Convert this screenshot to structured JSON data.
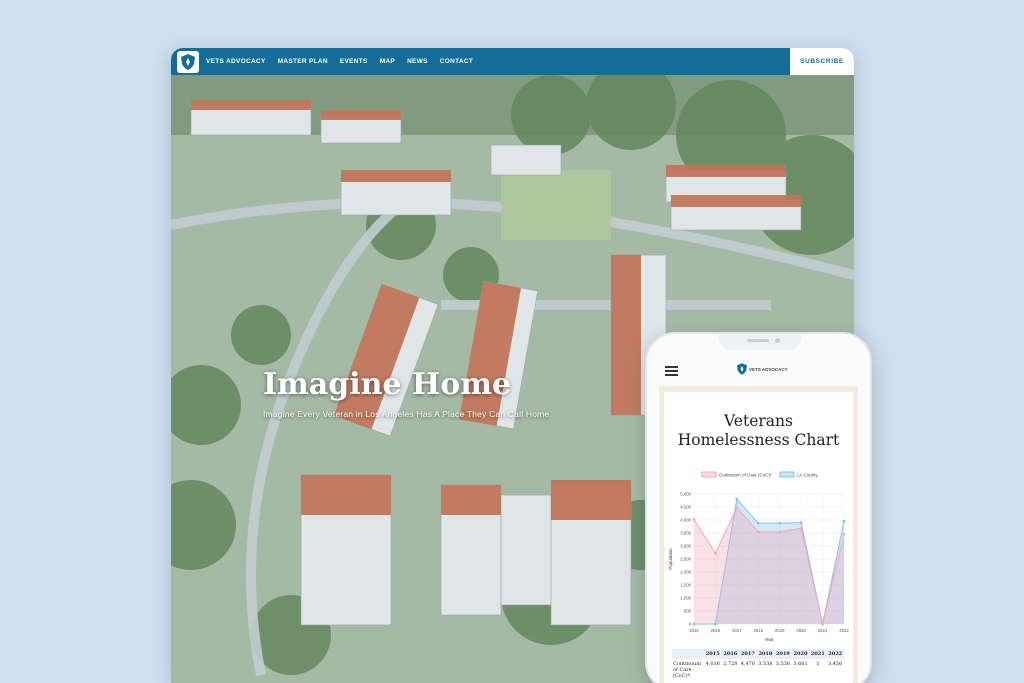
{
  "desktop": {
    "brand": "Vets Advocacy",
    "nav": [
      "Vets Advocacy",
      "Master Plan",
      "Events",
      "Map",
      "News",
      "Contact"
    ],
    "subscribe": "SUBSCRIBE",
    "hero": {
      "title": "Imagine Home",
      "subtitle": "Imagine Every Veteran in Los Angeles Has A Place They Can Call Home."
    }
  },
  "phone": {
    "logo_text": "VETS ADVOCACY",
    "chart_title_line1": "Veterans",
    "chart_title_line2": "Homelessness Chart",
    "table": {
      "headers": [
        "",
        "2015",
        "2016",
        "2017",
        "2018",
        "2019",
        "2020",
        "2021",
        "2022"
      ],
      "rows": [
        [
          "Continuum of Care (CoC)*",
          "4,016",
          "2,728",
          "4,476",
          "3,538",
          "3,538",
          "3,681",
          "‡",
          "3,456"
        ]
      ]
    }
  },
  "colors": {
    "nav": "#146c99",
    "coc": "#f4a7b9",
    "la": "#7ec3e8"
  },
  "chart_data": {
    "type": "area",
    "x": [
      2015,
      2016,
      2017,
      2018,
      2019,
      2020,
      2021,
      2022
    ],
    "series": [
      {
        "name": "Continuum of Care (CoC)*",
        "values": [
          4016,
          2728,
          4476,
          3538,
          3538,
          3681,
          0,
          3456
        ],
        "color": "#f4a7b9"
      },
      {
        "name": "LA County",
        "values": [
          0,
          0,
          4800,
          3878,
          3878,
          3900,
          0,
          3950
        ],
        "color": "#7ec3e8"
      }
    ],
    "xlabel": "Year",
    "ylabel": "Population",
    "ylim": [
      0,
      5000
    ],
    "yticks": [
      "0",
      "500",
      "1,000",
      "1,500",
      "2,000",
      "2,500",
      "3,000",
      "3,500",
      "4,000",
      "4,500",
      "5,000"
    ],
    "legend": "top",
    "grid": true
  }
}
